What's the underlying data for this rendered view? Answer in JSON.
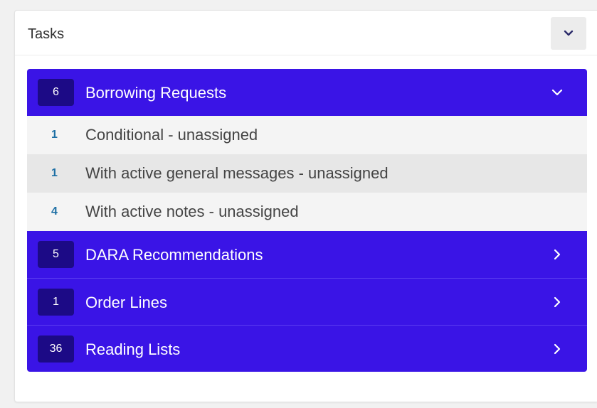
{
  "widget": {
    "title": "Tasks",
    "collapse_icon": "chevron-down-icon"
  },
  "colors": {
    "accent": "#3a14e6",
    "badge_bg": "#1c0a86",
    "count_text": "#1d6fa5"
  },
  "groups": [
    {
      "count": "6",
      "label": "Borrowing Requests",
      "expanded": true,
      "icon": "chevron-down-icon",
      "items": [
        {
          "count": "1",
          "label": "Conditional - unassigned"
        },
        {
          "count": "1",
          "label": "With active general messages - unassigned"
        },
        {
          "count": "4",
          "label": "With active notes - unassigned"
        }
      ]
    },
    {
      "count": "5",
      "label": "DARA Recommendations",
      "expanded": false,
      "icon": "chevron-right-icon"
    },
    {
      "count": "1",
      "label": "Order Lines",
      "expanded": false,
      "icon": "chevron-right-icon"
    },
    {
      "count": "36",
      "label": "Reading Lists",
      "expanded": false,
      "icon": "chevron-right-icon"
    }
  ]
}
